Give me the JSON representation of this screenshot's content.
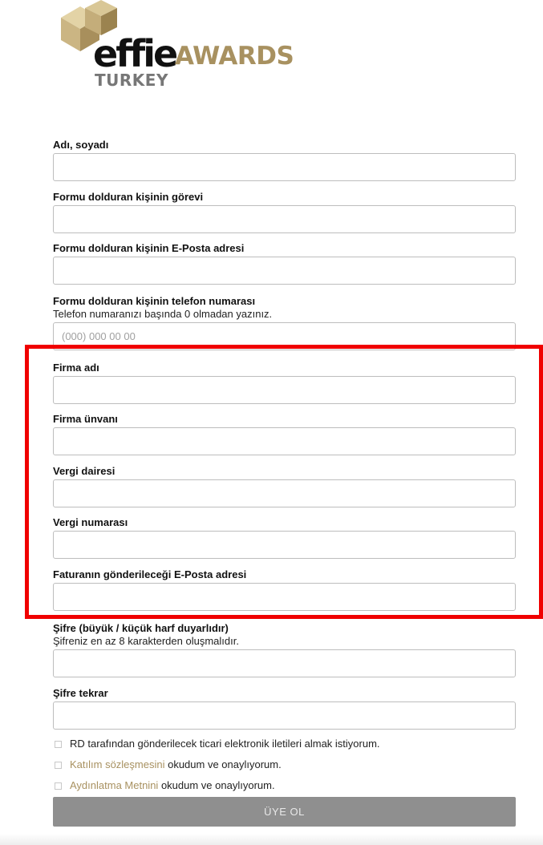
{
  "brand": {
    "logo_word": "effie",
    "logo_awards": "AWARDS",
    "logo_country": "TURKEY",
    "accent_color": "#a89160"
  },
  "form": {
    "full_name": {
      "label": "Adı, soyadı",
      "value": ""
    },
    "position": {
      "label": "Formu dolduran kişinin görevi",
      "value": ""
    },
    "email": {
      "label": "Formu dolduran kişinin E-Posta adresi",
      "value": ""
    },
    "phone": {
      "label": "Formu dolduran kişinin telefon numarası",
      "hint": "Telefon numaranızı başında 0 olmadan yazınız.",
      "placeholder": "(000) 000 00 00",
      "value": ""
    },
    "company_name": {
      "label": "Firma adı",
      "value": ""
    },
    "company_title": {
      "label": "Firma ünvanı",
      "value": ""
    },
    "tax_office": {
      "label": "Vergi dairesi",
      "value": ""
    },
    "tax_number": {
      "label": "Vergi numarası",
      "value": ""
    },
    "invoice_email": {
      "label": "Faturanın gönderileceği E-Posta adresi",
      "value": ""
    },
    "password": {
      "label": "Şifre (büyük / küçük harf duyarlıdır)",
      "hint": "Şifreniz en az 8 karakterden oluşmalıdır.",
      "value": ""
    },
    "password_repeat": {
      "label": "Şifre tekrar",
      "value": ""
    },
    "consents": {
      "marketing": {
        "text": "RD tarafından gönderilecek ticari elektronik iletileri almak istiyorum.",
        "checked": false
      },
      "agreement": {
        "link_text": "Katılım sözleşmesini",
        "text": " okudum ve onaylıyorum.",
        "checked": false
      },
      "privacy": {
        "link_text": "Aydınlatma Metnini",
        "text": " okudum ve onaylıyorum.",
        "checked": false
      }
    },
    "submit_label": "ÜYE OL"
  },
  "highlight_color": "#f00000"
}
